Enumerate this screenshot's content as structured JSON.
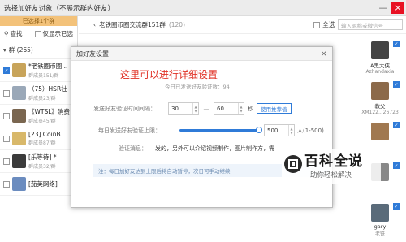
{
  "window": {
    "title": "选择加好友对象（不展示群内好友）"
  },
  "left": {
    "selected_bar": "已选择1个群",
    "find": "查找",
    "cancel_selected": "仅显示已选",
    "group_header": "群 (265)",
    "groups": [
      {
        "name": "*老铁圈币圈...",
        "sub": "群成员151/群",
        "checked": true,
        "color": "#c8a45a"
      },
      {
        "name": "（75）HSR社",
        "sub": "群成员23/群",
        "checked": false,
        "color": "#9aa8b8"
      },
      {
        "name": "《WTSL》消费",
        "sub": "群成员45/群",
        "checked": false,
        "color": "#7a6650"
      },
      {
        "name": "[23] CoinB",
        "sub": "群成员87/群",
        "checked": false,
        "color": "#d8b86a"
      },
      {
        "name": "[乐等待] *",
        "sub": "群成员32/群",
        "checked": false,
        "color": "#3b3b3b"
      },
      {
        "name": "[茄英网络]",
        "sub": "",
        "checked": false,
        "color": "#6b8cbf"
      }
    ]
  },
  "right": {
    "group_title": "老铁圈币圈交流群151群",
    "group_count": "(120)",
    "select_all": "全选",
    "search_placeholder": "输入昵称或微信号",
    "cards": [
      {
        "name": "A黑大侠",
        "sub": "Azhandaxia",
        "color": "#444"
      },
      {
        "name": "教父",
        "sub": "XM122...26723",
        "color": "#8c6a4a"
      },
      {
        "name": "",
        "sub": "",
        "color": "#a07850"
      },
      {
        "name": "",
        "sub": "",
        "color": "#888"
      },
      {
        "name": "gary",
        "sub": "老铁",
        "color": "#5a6b7a"
      }
    ]
  },
  "dialog": {
    "title": "加好友设置",
    "annotation": "这里可以进行详细设置",
    "today_sent": "今日已发送好友验证数：94",
    "interval_label": "发送好友验证时间间隔：",
    "interval_min": "30",
    "interval_max": "60",
    "interval_unit": "秒",
    "recommend_btn": "使用推荐值",
    "daily_label": "每日发送好友验证上限：",
    "daily_value": "500",
    "daily_fraction": 1.0,
    "daily_range": "人(1-500)",
    "message_label": "验证消息：",
    "message_value": "发的，另外可以介绍视频制作，图片制作方，需",
    "note": "注：每日加好友达到上限后将自动暂停，次日可手动继续"
  },
  "watermark": {
    "big": "百科全说",
    "small": "助你轻松解决"
  }
}
